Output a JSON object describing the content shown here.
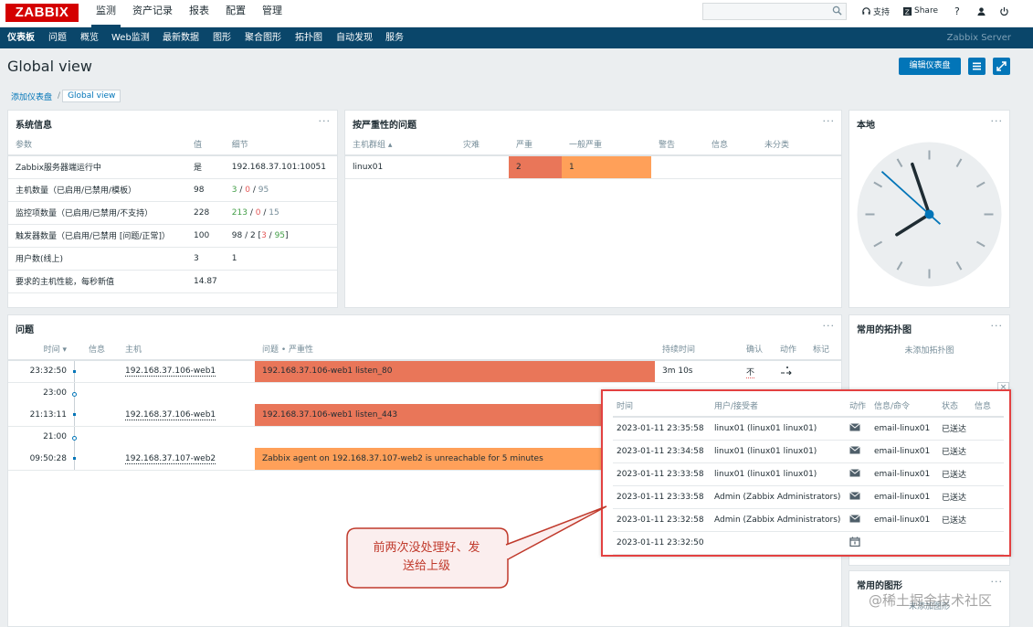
{
  "topbar": {
    "logo": "ZABBIX",
    "menu": [
      "监测",
      "资产记录",
      "报表",
      "配置",
      "管理"
    ],
    "support": "支持",
    "share": "Share",
    "help": "?"
  },
  "subnav": {
    "items": [
      "仪表板",
      "问题",
      "概览",
      "Web监测",
      "最新数据",
      "图形",
      "聚合图形",
      "拓扑图",
      "自动发现",
      "服务"
    ],
    "server": "Zabbix Server"
  },
  "header": {
    "title": "Global view",
    "edit_button": "编辑仪表盘"
  },
  "breadcrumb": {
    "link": "添加仪表盘",
    "sep": "/",
    "current": "Global view"
  },
  "sysinfo": {
    "title": "系统信息",
    "menu": "···",
    "headers": [
      "参数",
      "值",
      "细节"
    ],
    "rows": [
      {
        "param": "Zabbix服务器端运行中",
        "value": "是",
        "detail": "192.168.37.101:10051"
      },
      {
        "param": "主机数量（已启用/已禁用/模板）",
        "value": "98",
        "d1": "3",
        "d2": "0",
        "d3": "95"
      },
      {
        "param": "监控项数量（已启用/已禁用/不支持）",
        "value": "228",
        "d1": "213",
        "d2": "0",
        "d3": "15"
      },
      {
        "param": "触发器数量（已启用/已禁用 [问题/正常]）",
        "value": "100",
        "d1": "98 / 2 [",
        "d2": "3",
        "d3": "95",
        "d4": "]"
      },
      {
        "param": "用户数(线上)",
        "value": "3",
        "detail": "1"
      },
      {
        "param": "要求的主机性能，每秒新值",
        "value": "14.87",
        "detail": ""
      }
    ]
  },
  "severity": {
    "title": "按严重性的问题",
    "menu": "···",
    "headers": [
      "主机群组 ▴",
      "灾难",
      "严重",
      "一般严重",
      "警告",
      "信息",
      "未分类"
    ],
    "row": {
      "group": "linux01",
      "high": "2",
      "average": "1"
    }
  },
  "local": {
    "title": "本地",
    "menu": "···",
    "clock": {
      "hour": 7,
      "minute": 56,
      "second": 52
    }
  },
  "problems": {
    "title": "问题",
    "menu": "···",
    "headers": [
      "时间 ▾",
      "信息",
      "主机",
      "问题 • 严重性",
      "持续时间",
      "确认",
      "动作",
      "标记"
    ],
    "rows": [
      {
        "time": "23:32:50",
        "host": "192.168.37.106-web1",
        "problem": "192.168.37.106-web1 listen_80",
        "duration": "3m 10s",
        "ack": "不",
        "sev": "high"
      },
      {
        "marker": "23:00"
      },
      {
        "time": "21:13:11",
        "host": "192.168.37.106-web1",
        "problem": "192.168.37.106-web1 listen_443",
        "sev": "high"
      },
      {
        "marker": "21:00"
      },
      {
        "time": "09:50:28",
        "host": "192.168.37.107-web2",
        "problem": "Zabbix agent on 192.168.37.107-web2 is unreachable for 5 minutes",
        "sev": "avg"
      }
    ]
  },
  "maps": {
    "title": "常用的拓扑图",
    "menu": "···",
    "empty": "未添加拓扑图"
  },
  "graphs": {
    "title": "常用的图形",
    "menu": "···",
    "empty": "未添加图形"
  },
  "popup": {
    "close": "×",
    "headers": [
      "时间",
      "用户/接受者",
      "动作",
      "信息/命令",
      "状态",
      "信息"
    ],
    "rows": [
      {
        "time": "2023-01-11 23:35:58",
        "user": "linux01 (linux01 linux01)",
        "icon": "mail-icon",
        "cmd": "email-linux01",
        "status": "已送达"
      },
      {
        "time": "2023-01-11 23:34:58",
        "user": "linux01 (linux01 linux01)",
        "icon": "mail-icon",
        "cmd": "email-linux01",
        "status": "已送达"
      },
      {
        "time": "2023-01-11 23:33:58",
        "user": "linux01 (linux01 linux01)",
        "icon": "mail-icon",
        "cmd": "email-linux01",
        "status": "已送达"
      },
      {
        "time": "2023-01-11 23:33:58",
        "user": "Admin (Zabbix Administrators)",
        "icon": "mail-icon",
        "cmd": "email-linux01",
        "status": "已送达"
      },
      {
        "time": "2023-01-11 23:32:58",
        "user": "Admin (Zabbix Administrators)",
        "icon": "mail-icon",
        "cmd": "email-linux01",
        "status": "已送达"
      },
      {
        "time": "2023-01-11 23:32:50",
        "user": "",
        "icon": "calendar-icon",
        "cmd": "",
        "status": ""
      }
    ]
  },
  "callout": {
    "line1": "前两次没处理好、发",
    "line2": "送给上级"
  },
  "watermark": "@稀土掘金技术社区",
  "colors": {
    "brand": "#d40000",
    "nav": "#0a466a",
    "accent": "#0275b8",
    "high": "#e97659",
    "average": "#ffa059",
    "ok": "#429e47",
    "problem": "#e45959",
    "callout": "#c0392b"
  }
}
